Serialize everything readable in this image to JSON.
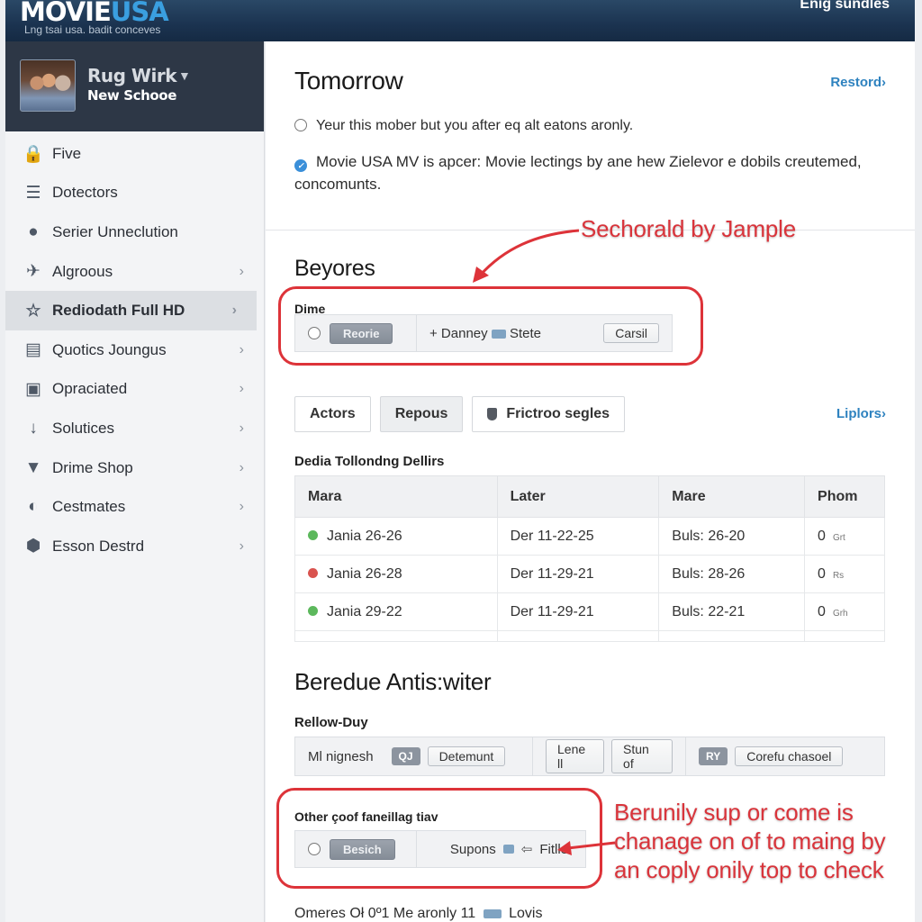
{
  "header": {
    "logo_part1": "MOVIE",
    "logo_part2": "USA",
    "tagline": "Lng tsai usa. badit conceves",
    "top_right": "Enig sundles",
    "brand_color": "#3a9fe0"
  },
  "profile": {
    "name": "Rug Wirk",
    "subtitle": "New Schooe",
    "dropdown_icon": "caret-down-icon"
  },
  "sidebar": {
    "items": [
      {
        "label": "Five",
        "icon": "lock-icon",
        "glyph": "🔒",
        "chevron": false,
        "active": false
      },
      {
        "label": "Dotectors",
        "icon": "list-icon",
        "glyph": "☰",
        "chevron": false,
        "active": false
      },
      {
        "label": "Serier Unneclution",
        "icon": "circle-icon",
        "glyph": "●",
        "chevron": false,
        "active": false
      },
      {
        "label": "Algroous",
        "icon": "plane-icon",
        "glyph": "✈",
        "chevron": true,
        "active": false
      },
      {
        "label": "Rediodath Full HD",
        "icon": "star-icon",
        "glyph": "☆",
        "chevron": true,
        "active": true
      },
      {
        "label": "Quotics Joungus",
        "icon": "clipboard-icon",
        "glyph": "▤",
        "chevron": true,
        "active": false
      },
      {
        "label": "Opraciated",
        "icon": "calendar-icon",
        "glyph": "▣",
        "chevron": true,
        "active": false
      },
      {
        "label": "Solutices",
        "icon": "arrow-down-icon",
        "glyph": "↓",
        "chevron": true,
        "active": false
      },
      {
        "label": "Drime Shop",
        "icon": "filter-icon",
        "glyph": "▼",
        "chevron": true,
        "active": false
      },
      {
        "label": "Cestmates",
        "icon": "globe-icon",
        "glyph": "◐",
        "chevron": true,
        "active": false
      },
      {
        "label": "Esson Destrd",
        "icon": "shield-icon",
        "glyph": "⬢",
        "chevron": true,
        "active": false
      }
    ],
    "chevron_glyph": "›"
  },
  "main": {
    "section1": {
      "title": "Tomorrow",
      "link": "Restord›",
      "option1": "Yeur this mober but you after eq alt eatons aronly.",
      "option2_line1": "Movie USA MV is apcer: Movie lectings by ane hew Zielevor e dobils creutemed,",
      "option2_line2": "concomunts."
    },
    "annotation1": "Sechorald by Jample",
    "section2": {
      "title": "Beyores",
      "bar_label": "Dime",
      "button": "Reorie",
      "add_label": "+ Danney",
      "add_suffix": "Stete",
      "cancel": "Carsil"
    },
    "tabs": [
      {
        "label": "Actors",
        "selected": false
      },
      {
        "label": "Repous",
        "selected": true
      },
      {
        "label": "Frictroo segles",
        "selected": false,
        "icon": "shield-icon"
      }
    ],
    "tabs_link": "Liplors›",
    "table": {
      "caption": "Dedia Tollondng Dellirs",
      "headers": [
        "Mara",
        "Later",
        "Mare",
        "Phom"
      ],
      "rows": [
        {
          "status": "green",
          "status_color": "#5cb85c",
          "name": "Jania 26-26",
          "later": "Der 11-22-25",
          "mare": "Buls: 26-20",
          "phom": "0",
          "unit": "Grt"
        },
        {
          "status": "red",
          "status_color": "#d9534f",
          "name": "Jania 26-28",
          "later": "Der 11-29-21",
          "mare": "Buls: 28-26",
          "phom": "0",
          "unit": "Rs"
        },
        {
          "status": "green",
          "status_color": "#5cb85c",
          "name": "Jania 29-22",
          "later": "Der 11-29-21",
          "mare": "Buls: 22-21",
          "phom": "0",
          "unit": "Grh"
        }
      ]
    },
    "section3": {
      "title": "Beredue Antis:witer",
      "bar_label": "Rellow-Duy",
      "cell1_label": "Ml nignesh",
      "cell1_tag": "QJ",
      "cell1_button": "Detemunt",
      "cell2_button1": "Lene ll",
      "cell2_button2": "Stun of",
      "cell3_tag": "RY",
      "cell3_button": "Corefu chasoel"
    },
    "section4": {
      "bar_label": "Other çoof faneillag tiav",
      "button": "Besich",
      "text": "Supons",
      "filter_label": "Fitller"
    },
    "annotation2_lines": [
      "Berunily sup or come is",
      "chanage on of to maing by",
      "an coply onily top to check"
    ],
    "footer_text": "Omeres Oł 0º1 Me aronly 11",
    "footer_suffix": "Lovis",
    "annotation_color": "#dd3339",
    "link_color": "#2e82bf"
  }
}
